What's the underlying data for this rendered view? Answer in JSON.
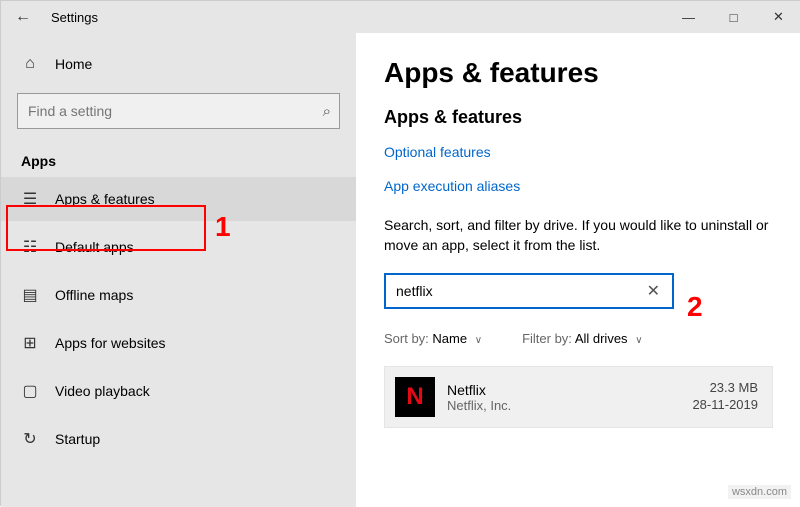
{
  "titlebar": {
    "title": "Settings"
  },
  "sidebar": {
    "home": "Home",
    "search_placeholder": "Find a setting",
    "section": "Apps",
    "items": [
      {
        "label": "Apps & features"
      },
      {
        "label": "Default apps"
      },
      {
        "label": "Offline maps"
      },
      {
        "label": "Apps for websites"
      },
      {
        "label": "Video playback"
      },
      {
        "label": "Startup"
      }
    ]
  },
  "main": {
    "heading": "Apps & features",
    "subheading": "Apps & features",
    "link_optional": "Optional features",
    "link_aliases": "App execution aliases",
    "description": "Search, sort, and filter by drive. If you would like to uninstall or move an app, select it from the list.",
    "search_value": "netflix",
    "sort_label": "Sort by:",
    "sort_value": "Name",
    "filter_label": "Filter by:",
    "filter_value": "All drives",
    "app": {
      "name": "Netflix",
      "publisher": "Netflix, Inc.",
      "size": "23.3 MB",
      "date": "28-11-2019",
      "icon_letter": "N"
    }
  },
  "annotations": {
    "callout1": "1",
    "callout2": "2"
  },
  "watermark": "wsxdn.com"
}
